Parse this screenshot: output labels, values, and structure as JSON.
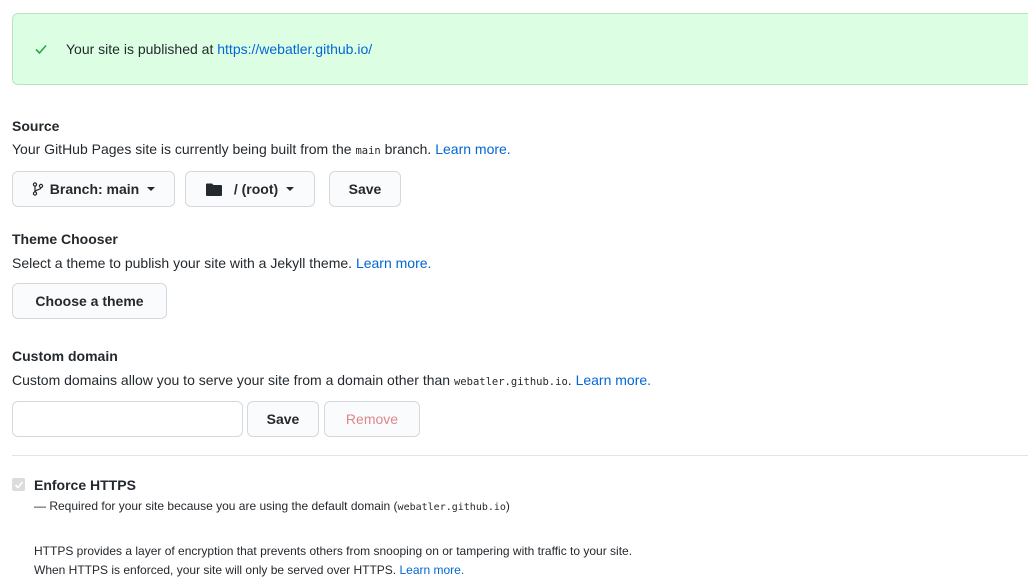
{
  "flash": {
    "message": "Your site is published at ",
    "url": "https://webatler.github.io/"
  },
  "source": {
    "title": "Source",
    "desc_prefix": "Your GitHub Pages site is currently being built from the ",
    "branch_code": "main",
    "desc_suffix": " branch. ",
    "learn_more": "Learn more.",
    "branch_button": "Branch: main",
    "folder_button": "/ (root)",
    "save_button": "Save"
  },
  "theme": {
    "title": "Theme Chooser",
    "desc": "Select a theme to publish your site with a Jekyll theme. ",
    "learn_more": "Learn more.",
    "choose_button": "Choose a theme"
  },
  "custom_domain": {
    "title": "Custom domain",
    "desc_prefix": "Custom domains allow you to serve your site from a domain other than ",
    "domain_code": "webatler.github.io",
    "desc_suffix": ". ",
    "learn_more": "Learn more.",
    "input_value": "",
    "save_button": "Save",
    "remove_button": "Remove"
  },
  "https": {
    "label": "Enforce HTTPS",
    "note_prefix": "— Required for your site because you are using the default domain (",
    "note_code": "webatler.github.io",
    "note_suffix": ")",
    "info_line1": "HTTPS provides a layer of encryption that prevents others from snooping on or tampering with traffic to your site.",
    "info_line2": "When HTTPS is enforced, your site will only be served over HTTPS. ",
    "learn_more": "Learn more.",
    "checked": true
  },
  "colors": {
    "flash_bg": "#dcffe4",
    "link": "#0366d6",
    "check": "#28a745",
    "disabled_text": "#e0868b"
  }
}
